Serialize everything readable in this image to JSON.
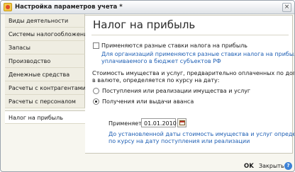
{
  "window": {
    "title": "Настройка параметров учета *",
    "close_glyph": "×"
  },
  "sidebar": {
    "items": [
      {
        "label": "Виды деятельности"
      },
      {
        "label": "Системы налогообложения"
      },
      {
        "label": "Запасы"
      },
      {
        "label": "Производство"
      },
      {
        "label": "Денежные средства"
      },
      {
        "label": "Расчеты с контрагентами"
      },
      {
        "label": "Расчеты с персоналом"
      },
      {
        "label": "Налог на прибыль"
      }
    ],
    "active_index": 7
  },
  "main": {
    "title": "Налог на прибыль",
    "checkbox_label": "Применяются разные ставки налога на прибыль",
    "checkbox_checked": false,
    "checkbox_note_line1": "Для организаций применяются разные ставки налога на прибыль,",
    "checkbox_note_line2": "уплачиваемого в бюджет субъектов РФ",
    "paragraph_line1": "Стоимость имущества и услуг, предварительно оплаченных по договору",
    "paragraph_line2": "в валюте, определяется по курсу на дату:",
    "radio_options": [
      {
        "label": "Поступления или реализации имущества и услуг",
        "checked": false
      },
      {
        "label": "Получения или выдачи аванса",
        "checked": true
      }
    ],
    "date_label": "Применяется с:",
    "date_value": "01.01.2010",
    "date_note_line1": "До установленной даты стоимость имущества и услуг определяется",
    "date_note_line2": "по курсу на дату поступления или реализации"
  },
  "footer": {
    "ok_label": "OK",
    "close_label": "Закрыть",
    "help_glyph": "?"
  },
  "colors": {
    "link_blue": "#1e5fb4",
    "panel_bg": "#f7f6ef"
  }
}
